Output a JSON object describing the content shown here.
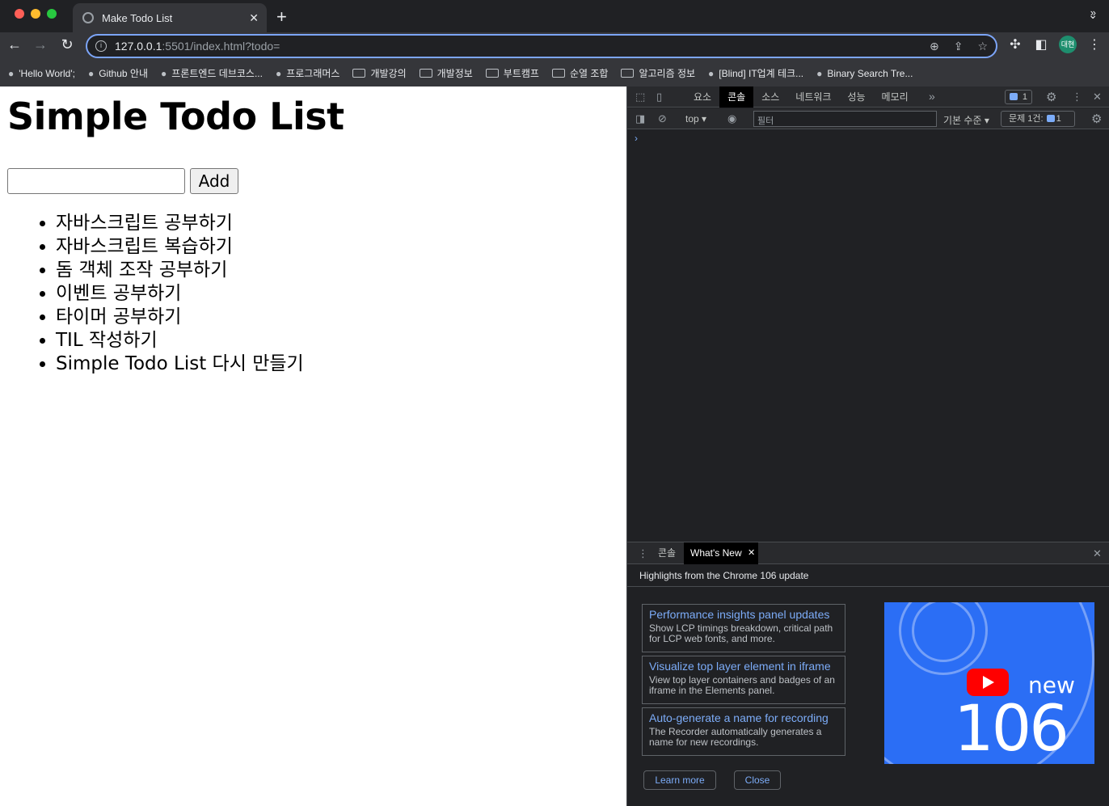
{
  "browser": {
    "tab_title": "Make Todo List",
    "url_host": "127.0.0.1",
    "url_rest": ":5501/index.html?todo=",
    "avatar_label": "대현",
    "bookmarks": [
      {
        "label": "'Hello World';",
        "icon": "dots-icon"
      },
      {
        "label": "Github 안내",
        "icon": "github-icon"
      },
      {
        "label": "프론트엔드 데브코스...",
        "icon": "chick-icon"
      },
      {
        "label": "프로그래머스",
        "icon": "programmers-icon"
      },
      {
        "label": "개발강의",
        "icon": "folder-icon"
      },
      {
        "label": "개발정보",
        "icon": "folder-icon"
      },
      {
        "label": "부트캠프",
        "icon": "folder-icon"
      },
      {
        "label": "순열 조합",
        "icon": "folder-icon"
      },
      {
        "label": "알고리즘 정보",
        "icon": "folder-icon"
      },
      {
        "label": "[Blind] IT업계 테크...",
        "icon": "blind-icon"
      },
      {
        "label": "Binary Search Tre...",
        "icon": "bst-icon"
      }
    ]
  },
  "page": {
    "title": "Simple Todo List",
    "input_value": "",
    "add_label": "Add",
    "todos": [
      "자바스크립트 공부하기",
      "자바스크립트 복습하기",
      "돔 객체 조작 공부하기",
      "이벤트 공부하기",
      "타이머 공부하기",
      "TIL 작성하기",
      "Simple Todo List 다시 만들기"
    ]
  },
  "devtools": {
    "tabs": [
      "요소",
      "콘솔",
      "소스",
      "네트워크",
      "성능",
      "메모리"
    ],
    "active_tab": "콘솔",
    "issues_count": "1",
    "context": "top ▾",
    "filter_placeholder": "필터",
    "level": "기본 수준 ▾",
    "problems_label": "문제 1건:",
    "problems_count": "1",
    "prompt": "›",
    "drawer": {
      "tabs": [
        "콘솔",
        "What's New"
      ],
      "active_tab": "What's New",
      "highlights": "Highlights from the Chrome 106 update",
      "cards": [
        {
          "title": "Performance insights panel updates",
          "desc": "Show LCP timings breakdown, critical path for LCP web fonts, and more."
        },
        {
          "title": "Visualize top layer element in iframe",
          "desc": "View top layer containers and badges of an iframe in the Elements panel."
        },
        {
          "title": "Auto-generate a name for recording",
          "desc": "The Recorder automatically generates a name for new recordings."
        }
      ],
      "promo_new": "new",
      "promo_version": "106",
      "learn_more": "Learn more",
      "close": "Close"
    }
  }
}
